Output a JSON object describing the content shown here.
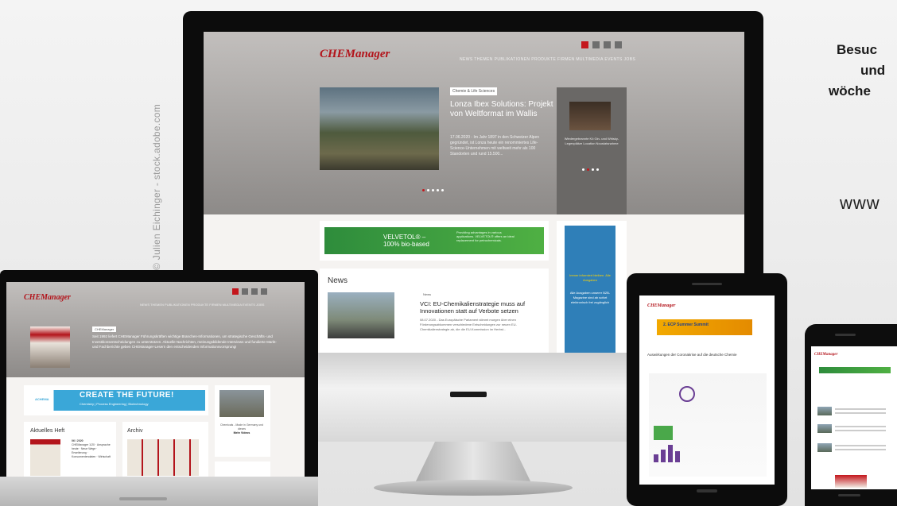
{
  "credit": "© Julien Eichinger - stock.adobe.com",
  "promo": {
    "line1": "Besuc",
    "line2": "und",
    "line3": "wöche",
    "url": "www"
  },
  "site": {
    "brand": "CHEManager",
    "brand_color": "#b3141b",
    "nav": "NEWS  THEMEN  PUBLIKATIONEN  PRODUKTE  FIRMEN  MULTIMEDIA  EVENTS  JOBS"
  },
  "monitor": {
    "hero": {
      "tag": "Chemie & Life Sciences",
      "title": "Lonza Ibex Solutions: Projekt von Weltformat im Wallis",
      "text": "17.06.2020 - Im Jahr 1897 in den Schweizer Alpen gegründet, ist Lonza heute ein renommiertes Life-Science-Unternehmen mit weltweit mehr als 100 Standorten und rund 15.500..."
    },
    "side": {
      "text": "Wiedergebrannte Kö Gin- und Whisky-Legenplätze Location Noustatsnahme"
    },
    "ad": {
      "title_line1": "VELVETOL® –",
      "title_line2": "100% bio-based",
      "sub": "Providing advantages in various applications. VELVETOL® offers an ideal replacement for petrochemicals."
    },
    "news": {
      "heading": "News",
      "tag": "News",
      "title": "VCI: EU-Chemikalienstrategie muss auf Innovationen statt auf Verbote setzen",
      "text": "08.07.2020 - Das Europäische Parlament stimmt morgen über einen Förderungsabkommen verschiedene Entscheidungen zur neuen EU-Chemikalienstrategie ab, die die EU-Kommission im Herbst..."
    },
    "side_ad": {
      "text": "Alle Ausgaben unserer B2B-Magazine sind ab sofort elektronisch frei zugänglich",
      "highlight": "Immer informiert bleiben. Alle Ausgaben"
    }
  },
  "laptop": {
    "tag": "CHEManager",
    "text": "Seit 1992 liefert CHEManager Führungskräften wichtige Branchen-Informationen, um strategische Geschäfts- und Investitionsentscheidungen zu unterstützen. Aktuelle Nachrichten, meinungsbildende Interviews und fundierte Markt- und Fachberichte geben CHEManager-Lesern den entscheidenden Informationsvorsprung!",
    "ad": {
      "brand": "ACHEMA",
      "title": "CREATE THE FUTURE!",
      "sub": "Chemistry | Process Engineering | Biotechnology"
    },
    "heft": {
      "heading": "Aktuelles Heft",
      "issue": "06 / 2020",
      "items": "CHEManager 1/20 · Ansprache heute · Neue Wege · Erweiterung · Konsumentendaten · Wirtschaft"
    },
    "archiv": {
      "heading": "Archiv"
    },
    "side": {
      "text": "Chemicals - Made in Germany und dieses",
      "link": "Mehr Videos"
    }
  },
  "tablet": {
    "ad": "2. ECP Summer Summit",
    "heading": "Auswirkungen der Coronakrise auf die deutsche Chemie"
  }
}
